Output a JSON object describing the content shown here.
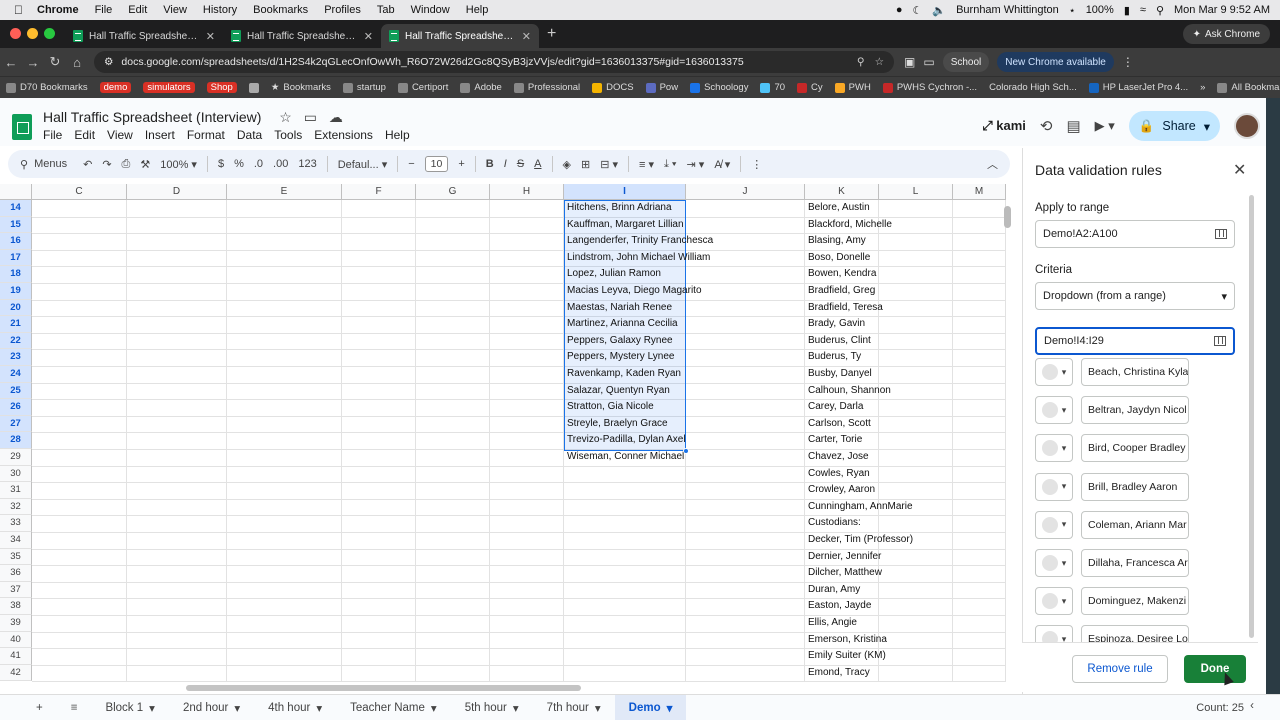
{
  "menubar": {
    "app": "Chrome",
    "items": [
      "File",
      "Edit",
      "View",
      "History",
      "Bookmarks",
      "Profiles",
      "Tab",
      "Window",
      "Help"
    ],
    "user": "Burnham Whittington",
    "battery": "100%",
    "datetime": "Mon Mar 9  9:52 AM"
  },
  "tabs": [
    {
      "title": "Hall Traffic Spreadsheet (Inte"
    },
    {
      "title": "Hall Traffic Spreadsheet (Inte"
    },
    {
      "title": "Hall Traffic Spreadsheet (Inte"
    }
  ],
  "ask_chrome": "Ask Chrome",
  "address": {
    "url": "docs.google.com/spreadsheets/d/1H2S4k2qGLecOnfOwWh_R6O72W26d2Gc8QSyB3jzVVjs/edit?gid=1636013375#gid=1636013375",
    "profile": "School",
    "update": "New Chrome available"
  },
  "bookmarks": [
    "D70 Bookmarks",
    "demo",
    "simulators",
    "Shop",
    "Bookmarks",
    "startup",
    "Certiport",
    "Adobe",
    "Professional",
    "DOCS",
    "Pow",
    "Schoology",
    "70",
    "Cy",
    "PWH",
    "PWHS Cychron -...",
    "Colorado High Sch...",
    "HP LaserJet Pro 4...",
    "All Bookmarks"
  ],
  "doc": {
    "title": "Hall Traffic Spreadsheet (Interview)",
    "menus": [
      "File",
      "Edit",
      "View",
      "Insert",
      "Format",
      "Data",
      "Tools",
      "Extensions",
      "Help"
    ],
    "kami": "kami",
    "share": "Share"
  },
  "toolbar": {
    "search": "Menus",
    "zoom": "100%",
    "currency": "$",
    "percent": "%",
    "dec_less": ".0",
    "dec_more": ".00",
    "numfmt": "123",
    "font": "Defaul...",
    "font_size": "10"
  },
  "grid": {
    "columns": [
      "C",
      "D",
      "E",
      "F",
      "G",
      "H",
      "I",
      "J",
      "K",
      "L",
      "M"
    ],
    "rows": [
      "14",
      "15",
      "16",
      "17",
      "18",
      "19",
      "20",
      "21",
      "22",
      "23",
      "24",
      "25",
      "26",
      "27",
      "28",
      "29",
      "30",
      "31",
      "32",
      "33",
      "34",
      "35",
      "36",
      "37",
      "38",
      "39",
      "40",
      "41",
      "42"
    ],
    "col_i": [
      "Hitchens, Brinn Adriana",
      "Kauffman, Margaret Lillian",
      "Langenderfer, Trinity Franchesca",
      "Lindstrom, John Michael William",
      "Lopez, Julian Ramon",
      "Macias Leyva, Diego Magarito",
      "Maestas, Nariah Renee",
      "Martinez, Arianna Cecilia",
      "Peppers, Galaxy Rynee",
      "Peppers, Mystery Lynee",
      "Ravenkamp, Kaden Ryan",
      "Salazar, Quentyn Ryan",
      "Stratton, Gia Nicole",
      "Streyle, Braelyn Grace",
      "Trevizo-Padilla, Dylan Axel",
      "Wiseman, Conner Michael"
    ],
    "col_k": [
      "Belore, Austin",
      "Blackford, Michelle",
      "Blasing, Amy",
      "Boso, Donelle",
      "Bowen, Kendra",
      "Bradfield, Greg",
      "Bradfield, Teresa",
      "Brady, Gavin",
      "Buderus, Clint",
      "Buderus, Ty",
      "Busby, Danyel",
      "Calhoun, Shannon",
      "Carey, Darla",
      "Carlson, Scott",
      "Carter, Torie",
      "Chavez, Jose",
      "Cowles, Ryan",
      "Crowley, Aaron",
      "Cunningham, AnnMarie",
      "Custodians:",
      "Decker, Tim (Professor)",
      "Dernier, Jennifer",
      "Dilcher, Matthew",
      "Duran, Amy",
      "Easton, Jayde",
      "Ellis, Angie",
      "Emerson, Kristina",
      "Emily Suiter (KM)",
      "Emond, Tracy"
    ]
  },
  "sheet_tabs": [
    "Block 1",
    "2nd hour",
    "4th hour",
    "Teacher Name",
    "5th hour",
    "7th hour",
    "Demo"
  ],
  "count": "Count: 25",
  "panel": {
    "title": "Data validation rules",
    "apply_label": "Apply to range",
    "apply_value": "Demo!A2:A100",
    "criteria_label": "Criteria",
    "criteria_value": "Dropdown (from a range)",
    "range_value": "Demo!I4:I29",
    "items": [
      "Beach, Christina Kyla",
      "Beltran, Jaydyn Nicol",
      "Bird, Cooper Bradley",
      "Brill, Bradley Aaron",
      "Coleman, Ariann Mar",
      "Dillaha, Francesca Ar",
      "Dominguez, Makenzi",
      "Espinoza, Desiree Lo"
    ],
    "remove": "Remove rule",
    "done": "Done"
  }
}
